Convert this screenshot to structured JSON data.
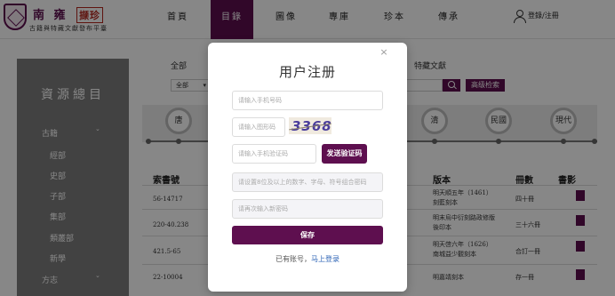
{
  "header": {
    "logo_title": "南 雍",
    "logo_stamp": "撷珍",
    "logo_subtitle": "古籍與特藏文獻發布平臺",
    "nav": [
      "首頁",
      "目錄",
      "圖像",
      "專庫",
      "珍本",
      "傳承"
    ],
    "active_nav": "目錄",
    "login_label": "登錄/注冊"
  },
  "sidebar": {
    "title": "資源總目",
    "items": [
      {
        "label": "古籍",
        "arrow": "⌄"
      },
      {
        "label": "經部"
      },
      {
        "label": "史部"
      },
      {
        "label": "子部"
      },
      {
        "label": "集部"
      },
      {
        "label": "類叢部"
      },
      {
        "label": "新學"
      },
      {
        "label": "方志",
        "arrow": "⌄"
      }
    ]
  },
  "filters": {
    "tabs": [
      "全部",
      "特藏文獻"
    ],
    "select_value": "全部",
    "advanced_search": "高级检索"
  },
  "timeline": {
    "eras": [
      "唐",
      "清",
      "民國",
      "現代"
    ]
  },
  "table": {
    "headers": [
      "索書號",
      "版本",
      "冊數",
      "書影"
    ],
    "rows": [
      {
        "call_no": "56-14717",
        "edition": "明天順五年（1461）刻藍刻本",
        "volumes": "四十冊"
      },
      {
        "call_no": "220-40.238",
        "edition": "明末烏中衍刻路政修版後印本",
        "volumes": "三十六冊"
      },
      {
        "call_no": "421.5-65",
        "edition": "明天啓六年（1626）南城益少觀刻本",
        "volumes": "合訂一冊"
      },
      {
        "call_no": "22-10004",
        "edition": "明嘉靖刻本",
        "volumes": "存一冊"
      }
    ]
  },
  "modal": {
    "title": "用户注册",
    "close_symbol": "×",
    "phone_placeholder": "请输入手机号码",
    "captcha_placeholder": "请输入图形码",
    "captcha_text": "3368",
    "sms_placeholder": "请输入手机验证码",
    "send_code_label": "发送验证码",
    "password_placeholder": "请设置8位及以上的数字、字母、符号组合密码",
    "confirm_placeholder": "请再次输入新密码",
    "save_label": "保存",
    "login_hint": "已有账号，",
    "login_link": "马上登录"
  },
  "colors": {
    "brand": "#5e0f4f",
    "overlay": "rgba(0,0,0,0.47)",
    "link": "#2c63b5"
  }
}
